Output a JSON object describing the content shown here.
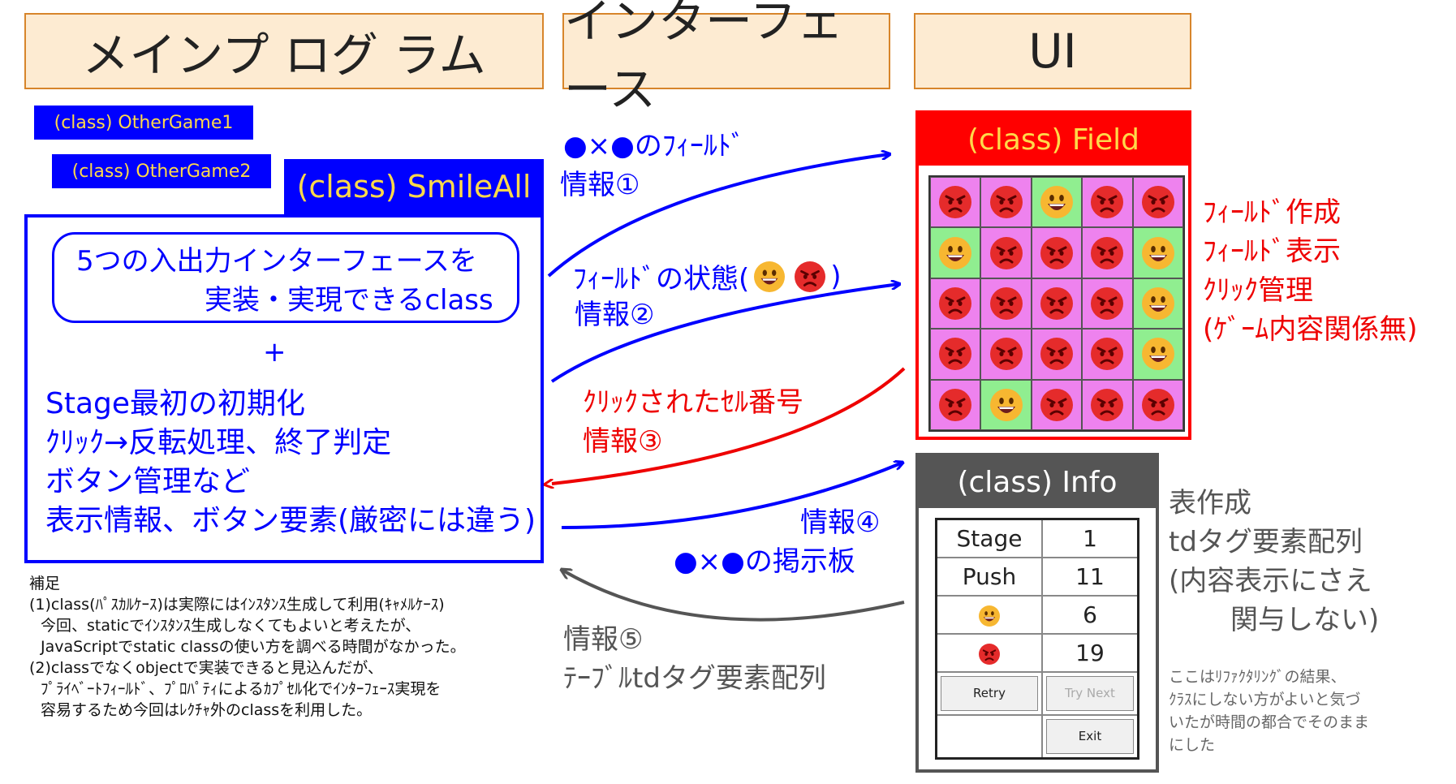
{
  "headers": {
    "main": "メインプ ログ ラム",
    "interface": "インターフェース",
    "ui": "UI"
  },
  "classes": {
    "other1": "(class) OtherGame1",
    "other2": "(class) OtherGame2",
    "smileall": "(class) SmileAll",
    "field": "(class) Field",
    "info": "(class) Info"
  },
  "smileall_box": {
    "inner_line1": "5つの入出力インターフェースを",
    "inner_line2": "実装・実現できるclass",
    "plus": "+",
    "items": [
      "Stage最初の初期化",
      "ｸﾘｯｸ→反転処理、終了判定",
      "ボタン管理など",
      "表示情報、ボタン要素(厳密には違う)"
    ]
  },
  "arrows": {
    "info1_line1": "●×●のﾌｨｰﾙﾄﾞ",
    "info1_line2": "情報①",
    "info2_prefix": "ﾌｨｰﾙﾄﾞの状態(",
    "info2_suffix": ")",
    "info2_line2": "情報②",
    "info3_line1": "ｸﾘｯｸされたｾﾙ番号",
    "info3_line2": "情報③",
    "info4_line1": "情報④",
    "info4_line2": "●×●の掲示板",
    "info5_line1": "情報⑤",
    "info5_line2": "ﾃｰﾌﾞﾙtdタグ要素配列"
  },
  "field_notes": [
    "ﾌｨｰﾙﾄﾞ作成",
    "ﾌｨｰﾙﾄﾞ表示",
    "ｸﾘｯｸ管理",
    "(ｹﾞｰﾑ内容関係無)"
  ],
  "field_grid": [
    [
      "angry",
      "angry",
      "smile",
      "angry",
      "angry"
    ],
    [
      "smile",
      "angry",
      "angry",
      "angry",
      "smile"
    ],
    [
      "angry",
      "angry",
      "angry",
      "angry",
      "smile"
    ],
    [
      "angry",
      "angry",
      "angry",
      "angry",
      "smile"
    ],
    [
      "angry",
      "smile",
      "angry",
      "angry",
      "angry"
    ]
  ],
  "info_table": {
    "rows": [
      {
        "label": "Stage",
        "value": "1"
      },
      {
        "label": "Push",
        "value": "11"
      },
      {
        "icon": "smile-face-icon",
        "value": "6"
      },
      {
        "icon": "angry-face-icon",
        "value": "19"
      }
    ],
    "retry": "Retry",
    "try_next": "Try Next",
    "exit": "Exit"
  },
  "info_notes": [
    "表作成",
    "tdタグ要素配列",
    "(内容表示にさえ",
    "関与しない)"
  ],
  "info_small": [
    "ここはﾘﾌｧｸﾀﾘﾝｸﾞの結果、",
    "ｸﾗｽにしない方がよいと気づ",
    "いたが時間の都合でそのまま",
    "にした"
  ],
  "supplement": {
    "title": "補足",
    "lines": [
      "(1)class(ﾊﾟｽｶﾙｹｰｽ)は実際にはｲﾝｽﾀﾝｽ生成して利用(ｷｬﾒﾙｹｰｽ)",
      "今回、staticでｲﾝｽﾀﾝｽ生成しなくてもよいと考えたが、",
      "JavaScriptでstatic classの使い方を調べる時間がなかった。",
      "(2)classでなくobjectで実装できると見込んだが、",
      "ﾌﾟﾗｲﾍﾞｰﾄﾌｨｰﾙﾄﾞ、ﾌﾟﾛﾊﾟﾃｨによるｶﾌﾟｾﾙ化でｲﾝﾀｰﾌｪｰｽ実現を",
      "容易するため今回はﾚｸﾁｬ外のclassを利用した。"
    ]
  },
  "colors": {
    "header_bg": "#fdebd2",
    "header_border": "#d7852b",
    "blue": "#0000ff",
    "yellow": "#ffd94a",
    "red": "#ff0000",
    "cell_pink": "#ee82ee",
    "cell_green": "#90ee90",
    "gray": "#555555"
  }
}
